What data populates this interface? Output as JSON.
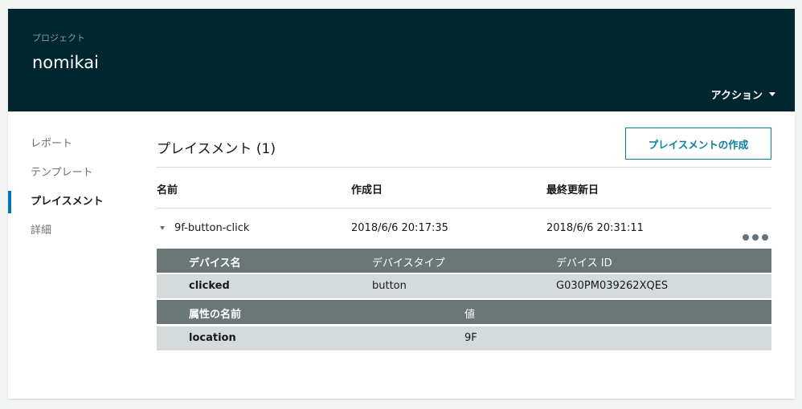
{
  "header": {
    "breadcrumb": "プロジェクト",
    "title": "nomikai",
    "actions_label": "アクション"
  },
  "nav": {
    "items": [
      {
        "label": "レポート"
      },
      {
        "label": "テンプレート"
      },
      {
        "label": "プレイスメント",
        "active": true
      },
      {
        "label": "詳細"
      }
    ]
  },
  "main": {
    "section_title": "プレイスメント (1)",
    "create_button": "プレイスメントの作成",
    "columns": [
      "名前",
      "作成日",
      "最終更新日"
    ],
    "row": {
      "name": "9f-button-click",
      "created": "2018/6/6 20:17:35",
      "updated": "2018/6/6 20:31:11"
    },
    "device_table": {
      "headers": [
        "デバイス名",
        "デバイスタイプ",
        "デバイス ID"
      ],
      "values": [
        "clicked",
        "button",
        "G030PM039262XQES"
      ]
    },
    "attribute_table": {
      "headers": [
        "属性の名前",
        "値"
      ],
      "values": [
        "location",
        "9F"
      ]
    }
  },
  "colors": {
    "header_bg": "#00272f",
    "accent": "#0a7fa0",
    "nav_active": "#0073bb",
    "subtable_header": "#6b7777",
    "subtable_row": "#d5dbdb"
  }
}
